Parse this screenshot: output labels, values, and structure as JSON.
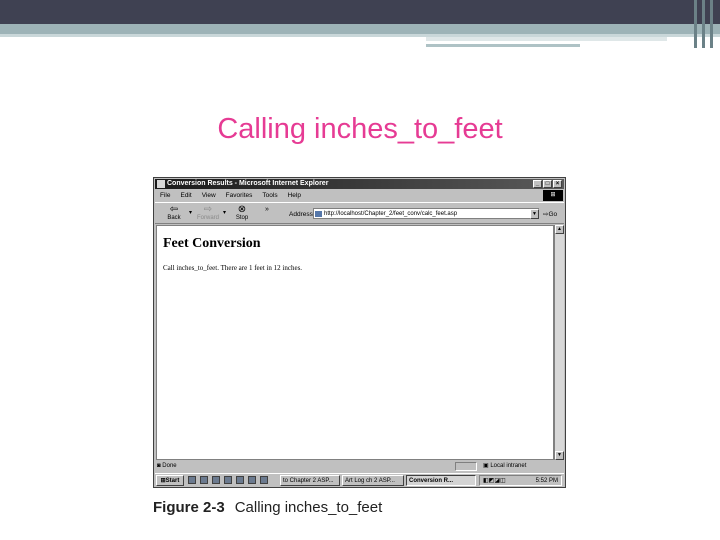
{
  "slide": {
    "title": "Calling inches_to_feet",
    "caption_label": "Figure 2-3",
    "caption_text": "Calling inches_to_feet",
    "title_color": "#e63b94"
  },
  "window": {
    "title": "Conversion Results - Microsoft Internet Explorer",
    "controls": [
      "_",
      "□",
      "×"
    ],
    "menu": [
      "File",
      "Edit",
      "View",
      "Favorites",
      "Tools",
      "Help"
    ],
    "toolbar": {
      "back_label": "Back",
      "forward_label": "Forward",
      "stop_label": "Stop",
      "more": "»"
    },
    "address_label": "Address",
    "address_value": "http://localhost/Chapter_2/feet_conv/calc_feet.asp",
    "go_label": "Go",
    "page": {
      "heading": "Feet Conversion",
      "text": "Call inches_to_feet. There are 1 feet in 12 inches."
    },
    "status": {
      "left": "Done",
      "zone": "Local intranet"
    }
  },
  "taskbar": {
    "start_label": "Start",
    "tasks": [
      {
        "label": "to Chapter 2 ASP...",
        "active": false
      },
      {
        "label": "Art Log ch 2 ASP...",
        "active": false
      },
      {
        "label": "Conversion R...",
        "active": true
      }
    ],
    "clock": "5:52 PM"
  }
}
